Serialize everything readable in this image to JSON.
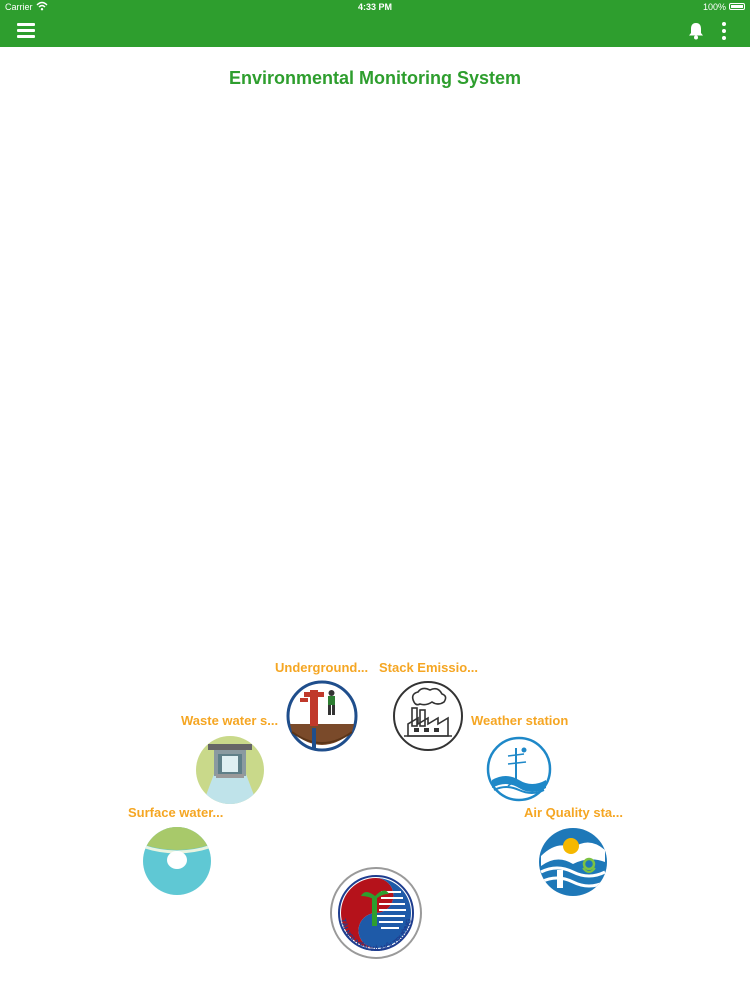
{
  "status_bar": {
    "carrier": "Carrier",
    "time": "4:33 PM",
    "battery": "100%"
  },
  "toolbar": {
    "menu_icon": "hamburger-menu-icon",
    "notification_icon": "bell-icon",
    "more_icon": "more-vertical-icon",
    "background_color": "#2e9e2e"
  },
  "page": {
    "title": "Environmental Monitoring System",
    "title_color": "#2e9e2e",
    "label_color": "#f5a623"
  },
  "stations": [
    {
      "id": "underground",
      "label": "Underground...",
      "icon": "groundwater-pump-icon"
    },
    {
      "id": "stack",
      "label": "Stack Emissio...",
      "icon": "factory-icon"
    },
    {
      "id": "waste",
      "label": "Waste water s...",
      "icon": "wastewater-gate-icon"
    },
    {
      "id": "weather",
      "label": "Weather station",
      "icon": "weather-tower-icon"
    },
    {
      "id": "surface",
      "label": "Surface water...",
      "icon": "surface-water-icon"
    },
    {
      "id": "air",
      "label": "Air Quality sta...",
      "icon": "air-quality-icon"
    }
  ],
  "center_logo": {
    "icon": "ministry-logo",
    "text": "TÀI NGUYÊN VÀ MÔI TRƯỜNG"
  }
}
